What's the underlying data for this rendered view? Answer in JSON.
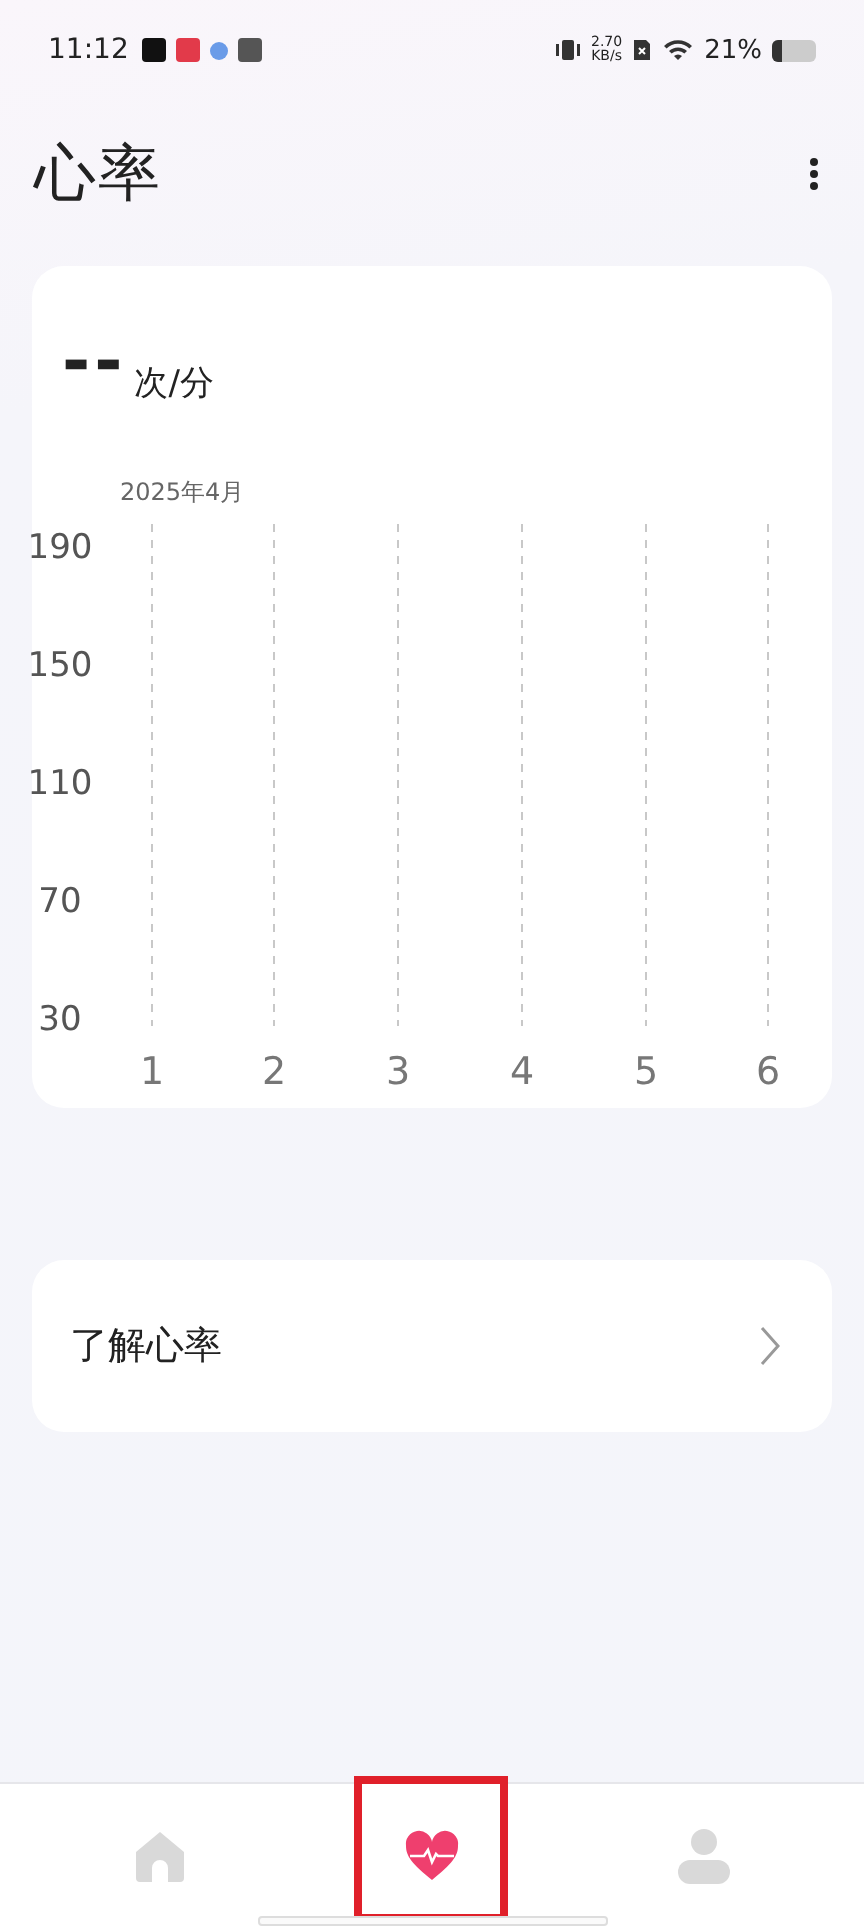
{
  "status_bar": {
    "time": "11:12",
    "speed_value": "2.70",
    "speed_unit": "KB/s",
    "battery": "21%"
  },
  "header": {
    "title": "心率"
  },
  "summary": {
    "value": "--",
    "unit": "次/分"
  },
  "chart_card": {
    "period": "2025年4月",
    "chart_data": {
      "type": "line",
      "categories": [
        "1",
        "2",
        "3",
        "4",
        "5",
        "6"
      ],
      "ylim": [
        30,
        190
      ],
      "yticks": [
        30,
        70,
        110,
        150,
        190
      ],
      "grid": true
    }
  },
  "info_card": {
    "label": "了解心率"
  },
  "nav": [
    {
      "kind": "home",
      "selected": false
    },
    {
      "kind": "heart",
      "selected": true
    },
    {
      "kind": "profile",
      "selected": false
    }
  ]
}
